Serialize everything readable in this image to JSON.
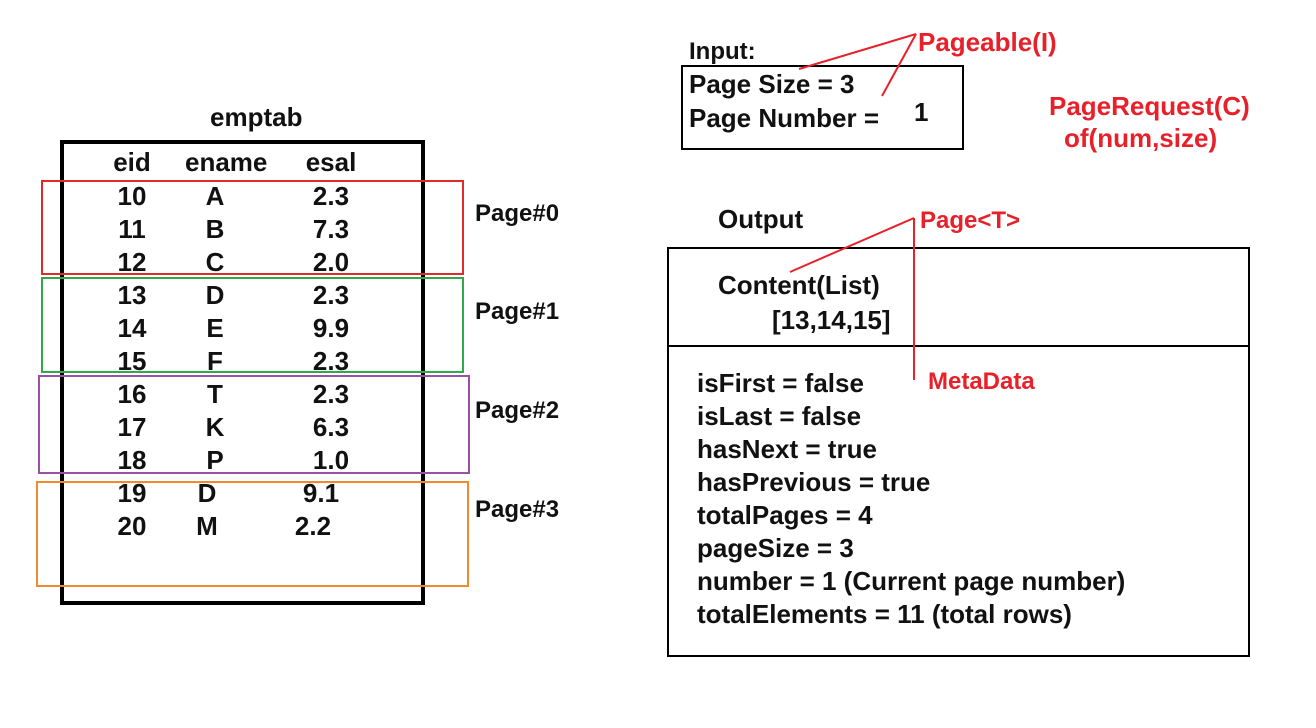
{
  "table": {
    "title": "emptab",
    "headers": [
      "eid",
      "ename",
      "esal"
    ],
    "rows": [
      {
        "eid": "10",
        "ename": "A",
        "esal": "2.3"
      },
      {
        "eid": "11",
        "ename": "B",
        "esal": "7.3"
      },
      {
        "eid": "12",
        "ename": "C",
        "esal": "2.0"
      },
      {
        "eid": "13",
        "ename": "D",
        "esal": "2.3"
      },
      {
        "eid": "14",
        "ename": "E",
        "esal": "9.9"
      },
      {
        "eid": "15",
        "ename": "F",
        "esal": "2.3"
      },
      {
        "eid": "16",
        "ename": "T",
        "esal": "2.3"
      },
      {
        "eid": "17",
        "ename": "K",
        "esal": "6.3"
      },
      {
        "eid": "18",
        "ename": "P",
        "esal": "1.0"
      },
      {
        "eid": "19",
        "ename": "D",
        "esal": "9.1"
      },
      {
        "eid": "20",
        "ename": "M",
        "esal": "2.2"
      }
    ]
  },
  "pages": [
    {
      "label": "Page#0",
      "color": "#e02b2b"
    },
    {
      "label": "Page#1",
      "color": "#2eaa4a"
    },
    {
      "label": "Page#2",
      "color": "#9b4fa5"
    },
    {
      "label": "Page#3",
      "color": "#ef8a2f"
    }
  ],
  "input": {
    "heading": "Input:",
    "page_size": "Page Size = 3",
    "page_number": "Page Number =",
    "page_number_value": "1"
  },
  "annotations": {
    "pageable": "Pageable(I)",
    "page_request": "PageRequest(C)",
    "page_request_of": "of(num,size)",
    "page_t": "Page<T>",
    "metadata": "MetaData"
  },
  "output": {
    "heading": "Output",
    "content_label": "Content(List)",
    "content_value": "[13,14,15]",
    "metadata_lines": [
      "isFirst = false",
      "isLast = false",
      "hasNext = true",
      "hasPrevious = true",
      "totalPages = 4",
      "pageSize = 3",
      "number = 1 (Current page number)",
      "totalElements = 11 (total rows)"
    ]
  },
  "colors": {
    "annotation_red": "#e8202a",
    "border": "#000000"
  }
}
